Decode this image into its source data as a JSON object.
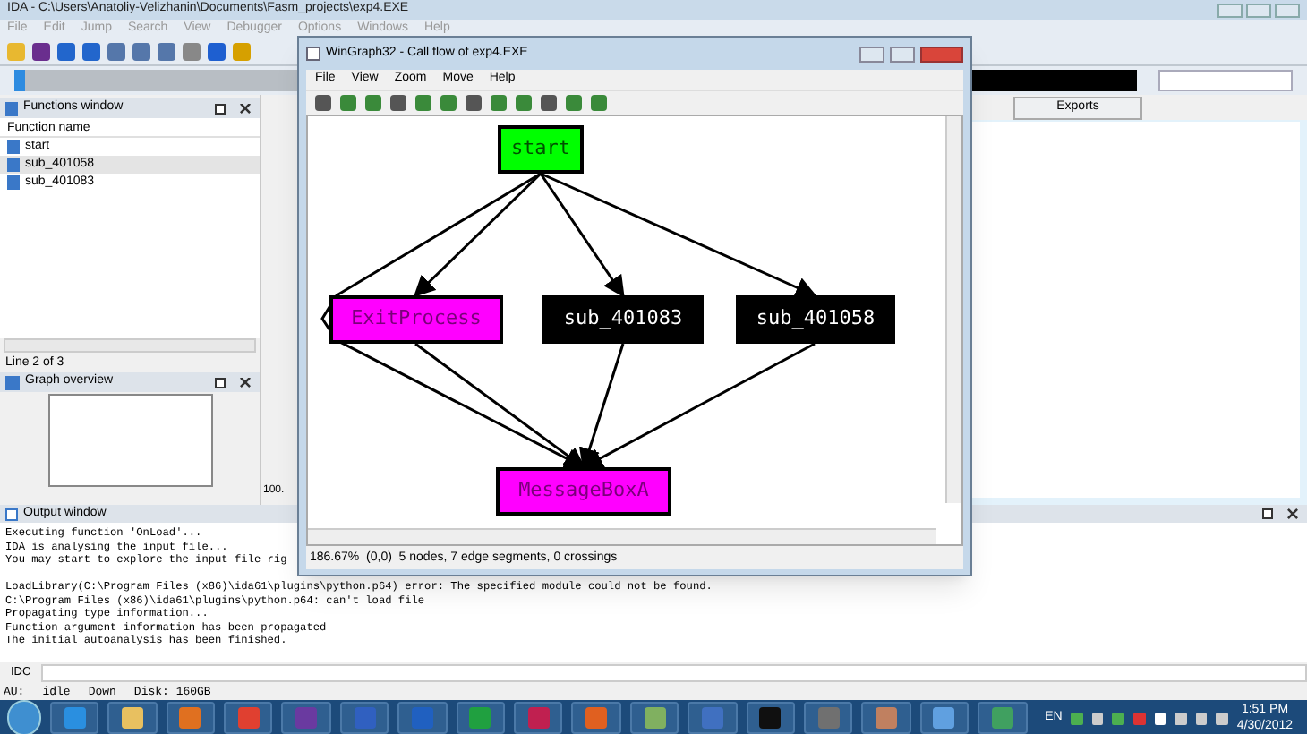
{
  "ida": {
    "title": "IDA - C:\\Users\\Anatoliy-Velizhanin\\Documents\\Fasm_projects\\exp4.EXE",
    "menu": [
      "File",
      "Edit",
      "Jump",
      "Search",
      "View",
      "Debugger",
      "Options",
      "Windows",
      "Help"
    ],
    "functions_window": {
      "title": "Functions window",
      "column": "Function name",
      "rows": [
        {
          "name": "start",
          "selected": false
        },
        {
          "name": "sub_401058",
          "selected": true
        },
        {
          "name": "sub_401083",
          "selected": false
        }
      ],
      "status": "Line 2 of 3"
    },
    "graph_overview": {
      "title": "Graph overview"
    },
    "hidden_text": "100.",
    "tabs": [
      {
        "label": "Exports",
        "selected": false
      }
    ],
    "output_window": {
      "title": "Output window",
      "lines": [
        {
          "text": "Executing function 'OnLoad'...",
          "gap_before": false
        },
        {
          "text": "IDA is analysing the input file...",
          "gap_before": false
        },
        {
          "text": "You may start to explore the input file rig",
          "gap_before": false
        },
        {
          "text": "LoadLibrary(C:\\Program Files (x86)\\ida61\\plugins\\python.p64) error: The specified module could not be found.",
          "gap_before": true
        },
        {
          "text": "C:\\Program Files (x86)\\ida61\\plugins\\python.p64: can't load file",
          "gap_before": false
        },
        {
          "text": "Propagating type information...",
          "gap_before": false
        },
        {
          "text": "Function argument information has been propagated",
          "gap_before": false
        },
        {
          "text": "The initial autoanalysis has been finished.",
          "gap_before": false
        }
      ]
    },
    "idc_label": "IDC",
    "status_bar": [
      "AU:",
      "idle",
      "Down",
      "Disk: 160GB"
    ]
  },
  "wingraph": {
    "title": "WinGraph32 - Call flow of exp4.EXE",
    "menu": [
      "File",
      "View",
      "Zoom",
      "Move",
      "Help"
    ],
    "nodes": [
      {
        "label": "start",
        "color": "#00ff00"
      },
      {
        "label": "ExitProcess",
        "color": "#ff00ff"
      },
      {
        "label": "sub_401083",
        "color": "#000000"
      },
      {
        "label": "sub_401058",
        "color": "#000000"
      },
      {
        "label": "MessageBoxA",
        "color": "#ff00ff"
      }
    ],
    "status": "186.67%  (0,0)  5 nodes, 7 edge segments, 0 crossings"
  },
  "taskbar": {
    "language": "EN",
    "time": "1:51 PM",
    "date": "4/30/2012"
  }
}
